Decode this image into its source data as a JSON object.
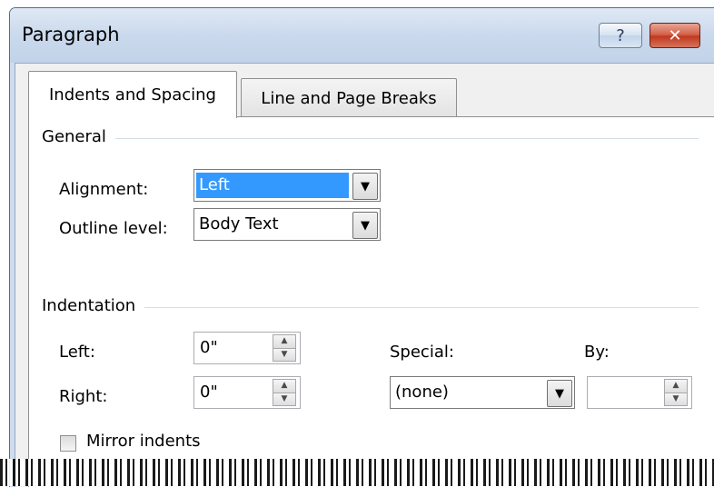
{
  "window": {
    "title": "Paragraph"
  },
  "titlebar_buttons": {
    "help": "?",
    "close": "✕"
  },
  "tabs": [
    {
      "label": "Indents and Spacing",
      "mnemonic_index": 0,
      "active": true
    },
    {
      "label": "Line and Page Breaks",
      "mnemonic_index": 14,
      "active": false
    }
  ],
  "general": {
    "heading": "General",
    "alignment": {
      "label": "Alignment:",
      "value": "Left"
    },
    "outline_level": {
      "label": "Outline level:",
      "value": "Body Text"
    }
  },
  "indentation": {
    "heading": "Indentation",
    "left": {
      "label": "Left:",
      "value": "0\""
    },
    "right": {
      "label": "Right:",
      "value": "0\""
    },
    "special": {
      "label": "Special:",
      "value": "(none)"
    },
    "by": {
      "label": "By:",
      "value": ""
    },
    "mirror_indents": {
      "label": "Mirror indents",
      "checked": false
    }
  },
  "colors": {
    "selection": "#3399ff",
    "close_button": "#c0391f",
    "titlebar": "#cad9ec"
  }
}
